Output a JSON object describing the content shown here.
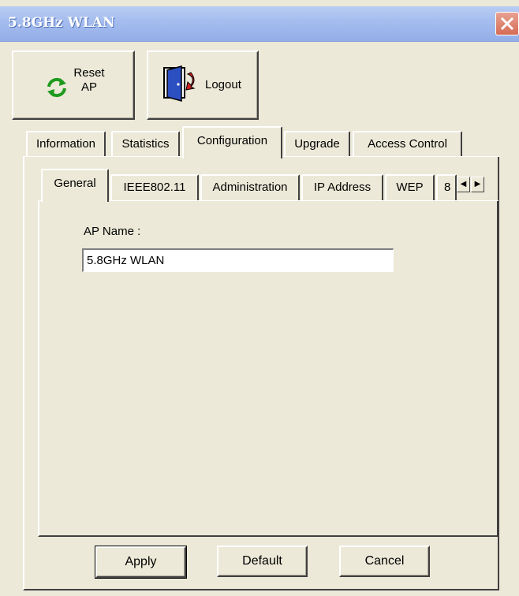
{
  "window": {
    "title": "5.8GHz WLAN"
  },
  "toolbar": {
    "reset_label_line1": "Reset",
    "reset_label_line2": "AP",
    "reset_icon": "refresh-icon",
    "logout_label": "Logout",
    "logout_icon": "exit-door-icon"
  },
  "main_tabs": {
    "information": "Information",
    "statistics": "Statistics",
    "configuration": "Configuration",
    "upgrade": "Upgrade",
    "access_control": "Access Control",
    "selected": "Configuration"
  },
  "sub_tabs": {
    "general": "General",
    "ieee": "IEEE802.11",
    "administration": "Administration",
    "ip_address": "IP Address",
    "wep": "WEP",
    "overflow": "8",
    "selected": "General"
  },
  "form": {
    "ap_name_label": "AP Name :",
    "ap_name_value": "5.8GHz WLAN"
  },
  "buttons": {
    "apply": "Apply",
    "default": "Default",
    "cancel": "Cancel"
  },
  "colors": {
    "window_bg": "#ece9d8",
    "title_bar": "#a4bcee",
    "close_button": "#d66c55"
  }
}
